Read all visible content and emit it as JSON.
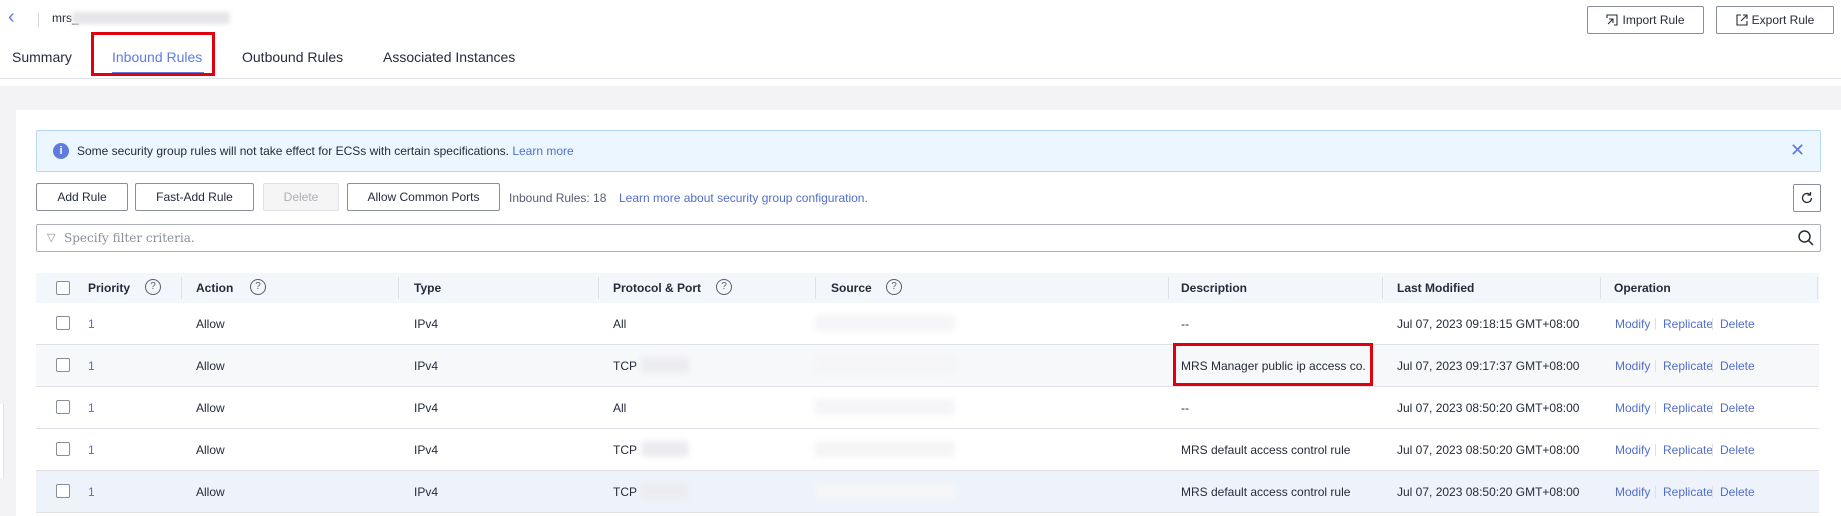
{
  "header": {
    "back_icon": "chevron-left-icon",
    "security_group_name": "mrs_",
    "import_label": "Import Rule",
    "export_label": "Export Rule"
  },
  "tabs": [
    {
      "label": "Summary"
    },
    {
      "label": "Inbound Rules",
      "active": true
    },
    {
      "label": "Outbound Rules"
    },
    {
      "label": "Associated Instances"
    }
  ],
  "banner": {
    "text": "Some security group rules will not take effect for ECSs with certain specifications.",
    "link": "Learn more"
  },
  "toolbar": {
    "add_rule": "Add Rule",
    "fast_add_rule": "Fast-Add Rule",
    "delete": "Delete",
    "allow_common_ports": "Allow Common Ports",
    "rule_count": "Inbound Rules: 18",
    "learn_more": "Learn more about security group configuration."
  },
  "filter": {
    "placeholder": "Specify filter criteria."
  },
  "table": {
    "columns": {
      "priority": "Priority",
      "action": "Action",
      "type": "Type",
      "protocol_port": "Protocol & Port",
      "source": "Source",
      "description": "Description",
      "last_modified": "Last Modified",
      "operation": "Operation"
    },
    "operations": {
      "modify": "Modify",
      "replicate": "Replicate",
      "delete": "Delete"
    },
    "rows": [
      {
        "priority": "1",
        "action": "Allow",
        "type": "IPv4",
        "protocol": "All",
        "description": "--",
        "last_modified": "Jul 07, 2023 09:18:15 GMT+08:00"
      },
      {
        "priority": "1",
        "action": "Allow",
        "type": "IPv4",
        "protocol": "TCP",
        "description": "MRS Manager public ip access co.",
        "last_modified": "Jul 07, 2023 09:17:37 GMT+08:00"
      },
      {
        "priority": "1",
        "action": "Allow",
        "type": "IPv4",
        "protocol": "All",
        "description": "--",
        "last_modified": "Jul 07, 2023 08:50:20 GMT+08:00"
      },
      {
        "priority": "1",
        "action": "Allow",
        "type": "IPv4",
        "protocol": "TCP",
        "description": "MRS default access control rule",
        "last_modified": "Jul 07, 2023 08:50:20 GMT+08:00"
      },
      {
        "priority": "1",
        "action": "Allow",
        "type": "IPv4",
        "protocol": "TCP",
        "description": "MRS default access control rule",
        "last_modified": "Jul 07, 2023 08:50:20 GMT+08:00"
      }
    ]
  },
  "colors": {
    "accent": "#5e7ce0",
    "link": "#526ecc",
    "highlight": "#e0000e"
  }
}
